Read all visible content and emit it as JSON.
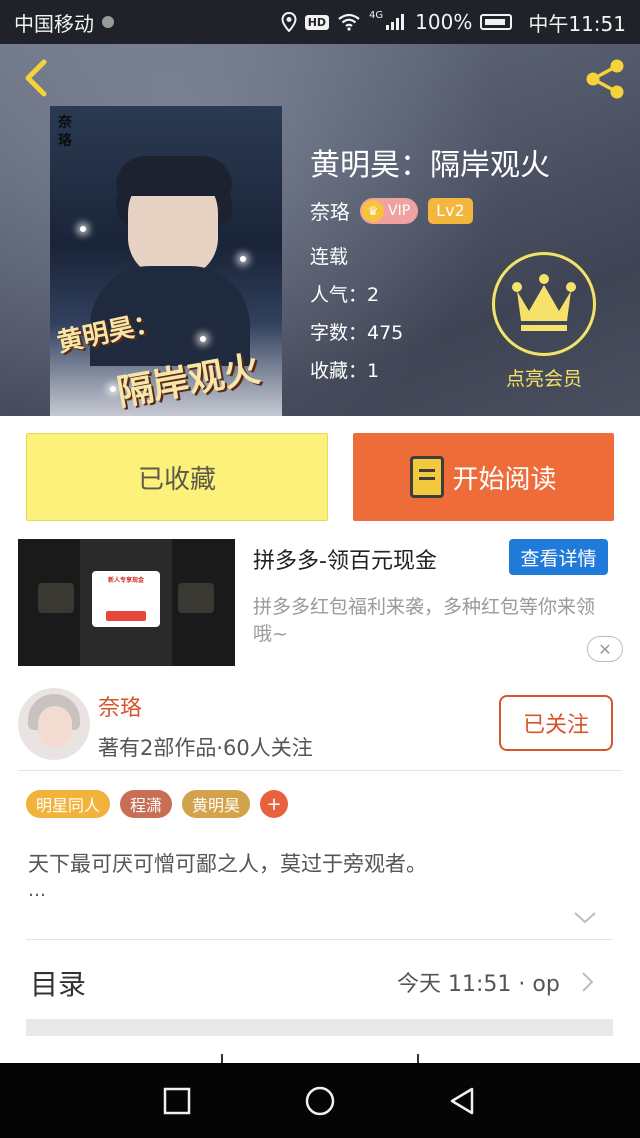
{
  "status_bar": {
    "carrier": "中国移动",
    "hd": "HD",
    "network": "4G",
    "battery_percent": "100%",
    "time": "中午11:51"
  },
  "book": {
    "title": "黄明昊：隔岸观火",
    "author": "奈珞",
    "vip_label": "VIP",
    "level": "Lv2",
    "status": "连载",
    "popularity": "人气：2",
    "word_count": "字数：475",
    "favorites": "收藏：1",
    "cover": {
      "author_mark": "奈珞",
      "title_line1": "黄明昊：",
      "title_line2": "隔岸观火"
    }
  },
  "membership": {
    "label": "点亮会员",
    "color": "#f6e26a"
  },
  "actions": {
    "collected_label": "已收藏",
    "read_label": "开始阅读"
  },
  "ad": {
    "title": "拼多多-领百元现金",
    "detail_button": "查看详情",
    "description": "拼多多红包福利来袭，多种红包等你来领哦~",
    "thumb_card_title": "新人专享现金",
    "close_icon": "close-icon"
  },
  "author_card": {
    "name": "奈珞",
    "stats": "著有2部作品·60人关注",
    "follow_label": "已关注"
  },
  "tags": [
    {
      "label": "明星同人",
      "color": "#f2b33d"
    },
    {
      "label": "程潇",
      "color": "#c86e54"
    },
    {
      "label": "黄明昊",
      "color": "#d4a24a"
    }
  ],
  "tag_add": "+",
  "intro": {
    "text": "天下最可厌可憎可鄙之人，莫过于旁观者。",
    "ellipsis": "…"
  },
  "toc": {
    "label": "目录",
    "update": "今天 11:51 · op"
  },
  "colors": {
    "accent": "#ed6c3a",
    "collected": "#fbf17b",
    "link_blue": "#1f7ad9",
    "author_red": "#d9542b"
  }
}
